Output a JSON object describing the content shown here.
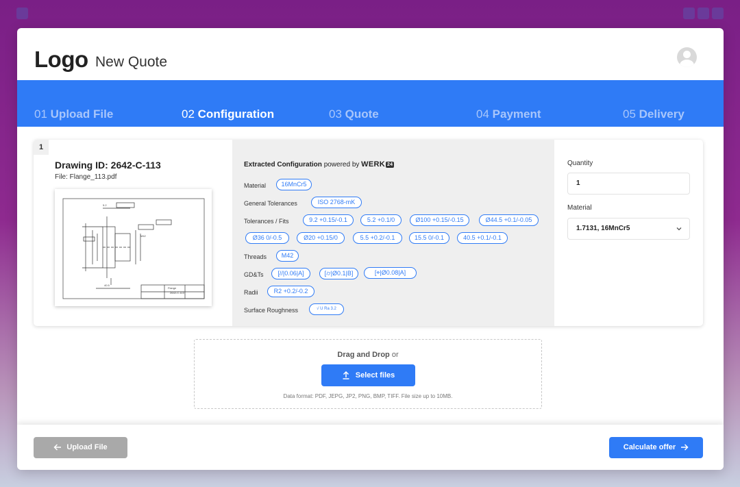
{
  "app": {
    "logo": "Logo",
    "page_title": "New Quote"
  },
  "steps": [
    {
      "num": "01",
      "label": "Upload File"
    },
    {
      "num": "02",
      "label": "Configuration"
    },
    {
      "num": "03",
      "label": "Quote"
    },
    {
      "num": "04",
      "label": "Payment"
    },
    {
      "num": "05",
      "label": "Delivery"
    }
  ],
  "active_step": 1,
  "item": {
    "index": "1",
    "drawing_title": "Drawing ID: 2642-C-113",
    "file_name": "File: Flange_113.pdf"
  },
  "config": {
    "title_bold": "Extracted Configuration",
    "powered_by": "powered by",
    "brand": "WERK",
    "brand_badge": "24",
    "rows": {
      "material": {
        "label": "Material",
        "chips": [
          "16MnCr5"
        ]
      },
      "general_tolerances": {
        "label": "General Tolerances",
        "chips": [
          "ISO 2768-mK"
        ]
      },
      "tolerances_fits": {
        "label": "Tolerances / Fits",
        "chips": [
          "9.2 +0.15/-0.1",
          "5.2 +0.1/0",
          "Ø100 +0.15/-0.15",
          "Ø44.5 +0.1/-0.05",
          "Ø36 0/-0.5",
          "Ø20 +0.15/0",
          "5.5 +0.2/-0.1",
          "15.5 0/-0.1",
          "40.5 +0.1/-0.1"
        ]
      },
      "threads": {
        "label": "Threads",
        "chips": [
          "M42"
        ]
      },
      "gdts": {
        "label": "GD&Ts",
        "chips": [
          "[//|0.06|A]",
          "[⌭|Ø0.1|B]",
          "[⌖|Ø0.08|A]"
        ]
      },
      "radii": {
        "label": "Radii",
        "chips": [
          "R2 +0.2/-0.2"
        ]
      },
      "surface_roughness": {
        "label": "Surface Roughness",
        "chips": [
          "√ U Ra 3.2"
        ]
      }
    }
  },
  "form": {
    "quantity_label": "Quantity",
    "quantity_value": "1",
    "material_label": "Material",
    "material_value": "1.7131, 16MnCr5"
  },
  "dropzone": {
    "drag_text": "Drag and Drop",
    "or_text": "or",
    "button_label": "Select files",
    "format_text": "Data format: PDF, JEPG, JP2, PNG, BMP, TIFF. File size up to 10MB."
  },
  "footer": {
    "back_label": "Upload File",
    "next_label": "Calculate offer"
  },
  "colors": {
    "accent": "#2f7bf6",
    "disabled": "#a9a9a9",
    "config_bg": "#efefef"
  }
}
